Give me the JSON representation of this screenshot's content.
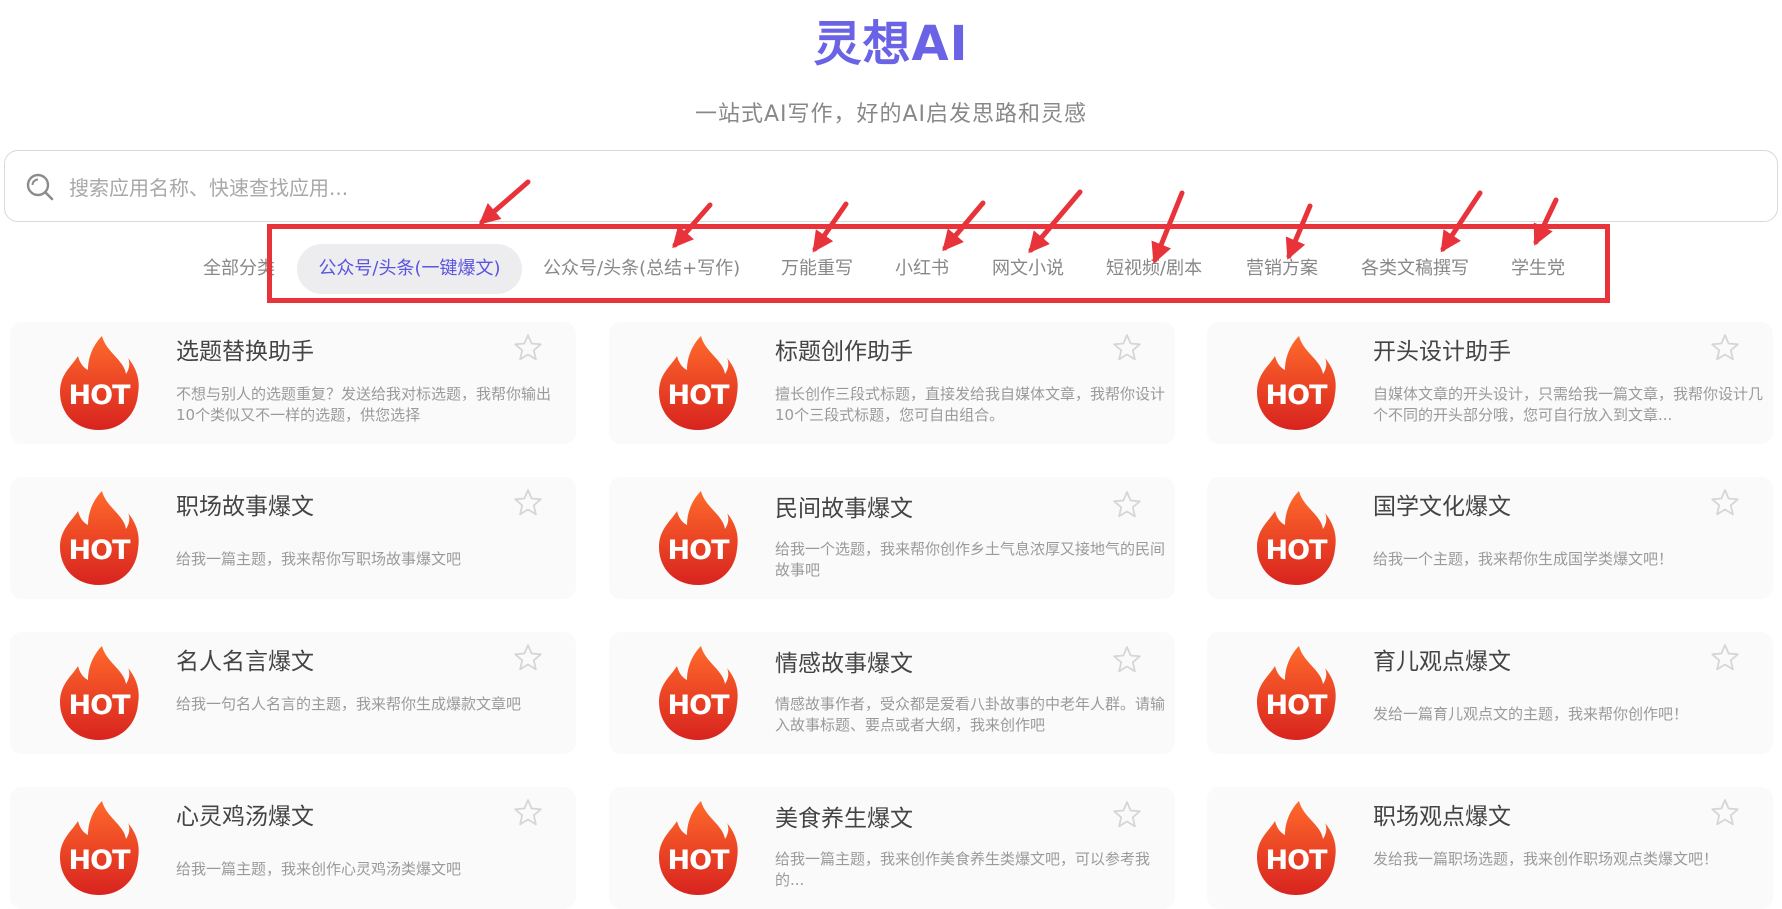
{
  "brand": {
    "title": "灵想AI",
    "subtitle": "一站式AI写作，好的AI启发思路和灵感"
  },
  "search": {
    "placeholder": "搜索应用名称、快速查找应用..."
  },
  "categories": [
    {
      "label": "全部分类"
    },
    {
      "label": "公众号/头条(一键爆文)",
      "active": true
    },
    {
      "label": "公众号/头条(总结+写作)"
    },
    {
      "label": "万能重写"
    },
    {
      "label": "小红书"
    },
    {
      "label": "网文小说"
    },
    {
      "label": "短视频/剧本"
    },
    {
      "label": "营销方案"
    },
    {
      "label": "各类文稿撰写"
    },
    {
      "label": "学生党"
    }
  ],
  "badge": {
    "text": "HOT"
  },
  "apps": [
    {
      "title": "选题替换助手",
      "desc": "不想与别人的选题重复？发送给我对标选题，我帮你输出10个类似又不一样的选题，供您选择"
    },
    {
      "title": "标题创作助手",
      "desc": "擅长创作三段式标题，直接发给我自媒体文章，我帮你设计10个三段式标题，您可自由组合。"
    },
    {
      "title": "开头设计助手",
      "desc": "自媒体文章的开头设计，只需给我一篇文章，我帮你设计几个不同的开头部分哦，您可自行放入到文章..."
    },
    {
      "title": "职场故事爆文",
      "desc": "给我一篇主题，我来帮你写职场故事爆文吧"
    },
    {
      "title": "民间故事爆文",
      "desc": "给我一个选题，我来帮你创作乡土气息浓厚又接地气的民间故事吧"
    },
    {
      "title": "国学文化爆文",
      "desc": "给我一个主题，我来帮你生成国学类爆文吧！"
    },
    {
      "title": "名人名言爆文",
      "desc": "给我一句名人名言的主题，我来帮你生成爆款文章吧"
    },
    {
      "title": "情感故事爆文",
      "desc": "情感故事作者，受众都是爱看八卦故事的中老年人群。请输入故事标题、要点或者大纲，我来创作吧"
    },
    {
      "title": "育儿观点爆文",
      "desc": "发给一篇育儿观点文的主题，我来帮你创作吧！"
    },
    {
      "title": "心灵鸡汤爆文",
      "desc": "给我一篇主题，我来创作心灵鸡汤类爆文吧"
    },
    {
      "title": "美食养生爆文",
      "desc": "给我一篇主题，我来创作美食养生类爆文吧，可以参考我的..."
    },
    {
      "title": "职场观点爆文",
      "desc": "发给我一篇职场选题，我来创作职场观点类爆文吧！"
    }
  ],
  "colors": {
    "brand": "#6b63e6",
    "annotation": "#e8333a",
    "hot_top": "#ff6a2b",
    "hot_bottom": "#d8231f"
  },
  "icons": {
    "search": "search-icon",
    "badge": "hot-flame-icon",
    "favorite": "star-outline-icon"
  }
}
